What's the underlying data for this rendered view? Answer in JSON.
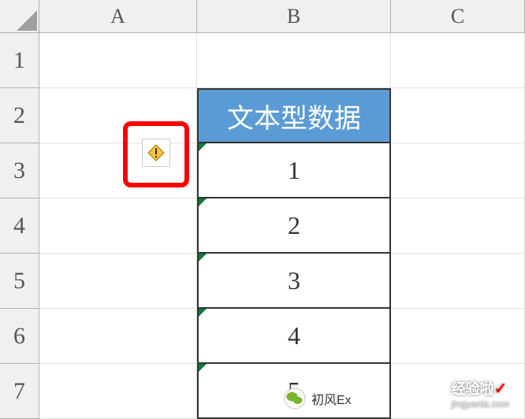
{
  "columns": {
    "A": "A",
    "B": "B",
    "C": "C"
  },
  "rows": {
    "1": "1",
    "2": "2",
    "3": "3",
    "4": "4",
    "5": "5",
    "6": "6",
    "7": "7"
  },
  "table": {
    "header": "文本型数据",
    "values": [
      "1",
      "2",
      "3",
      "4",
      "5"
    ]
  },
  "watermark": {
    "site": "经验啦",
    "url": "jingyanla.com",
    "prefix": "初风Ex"
  }
}
